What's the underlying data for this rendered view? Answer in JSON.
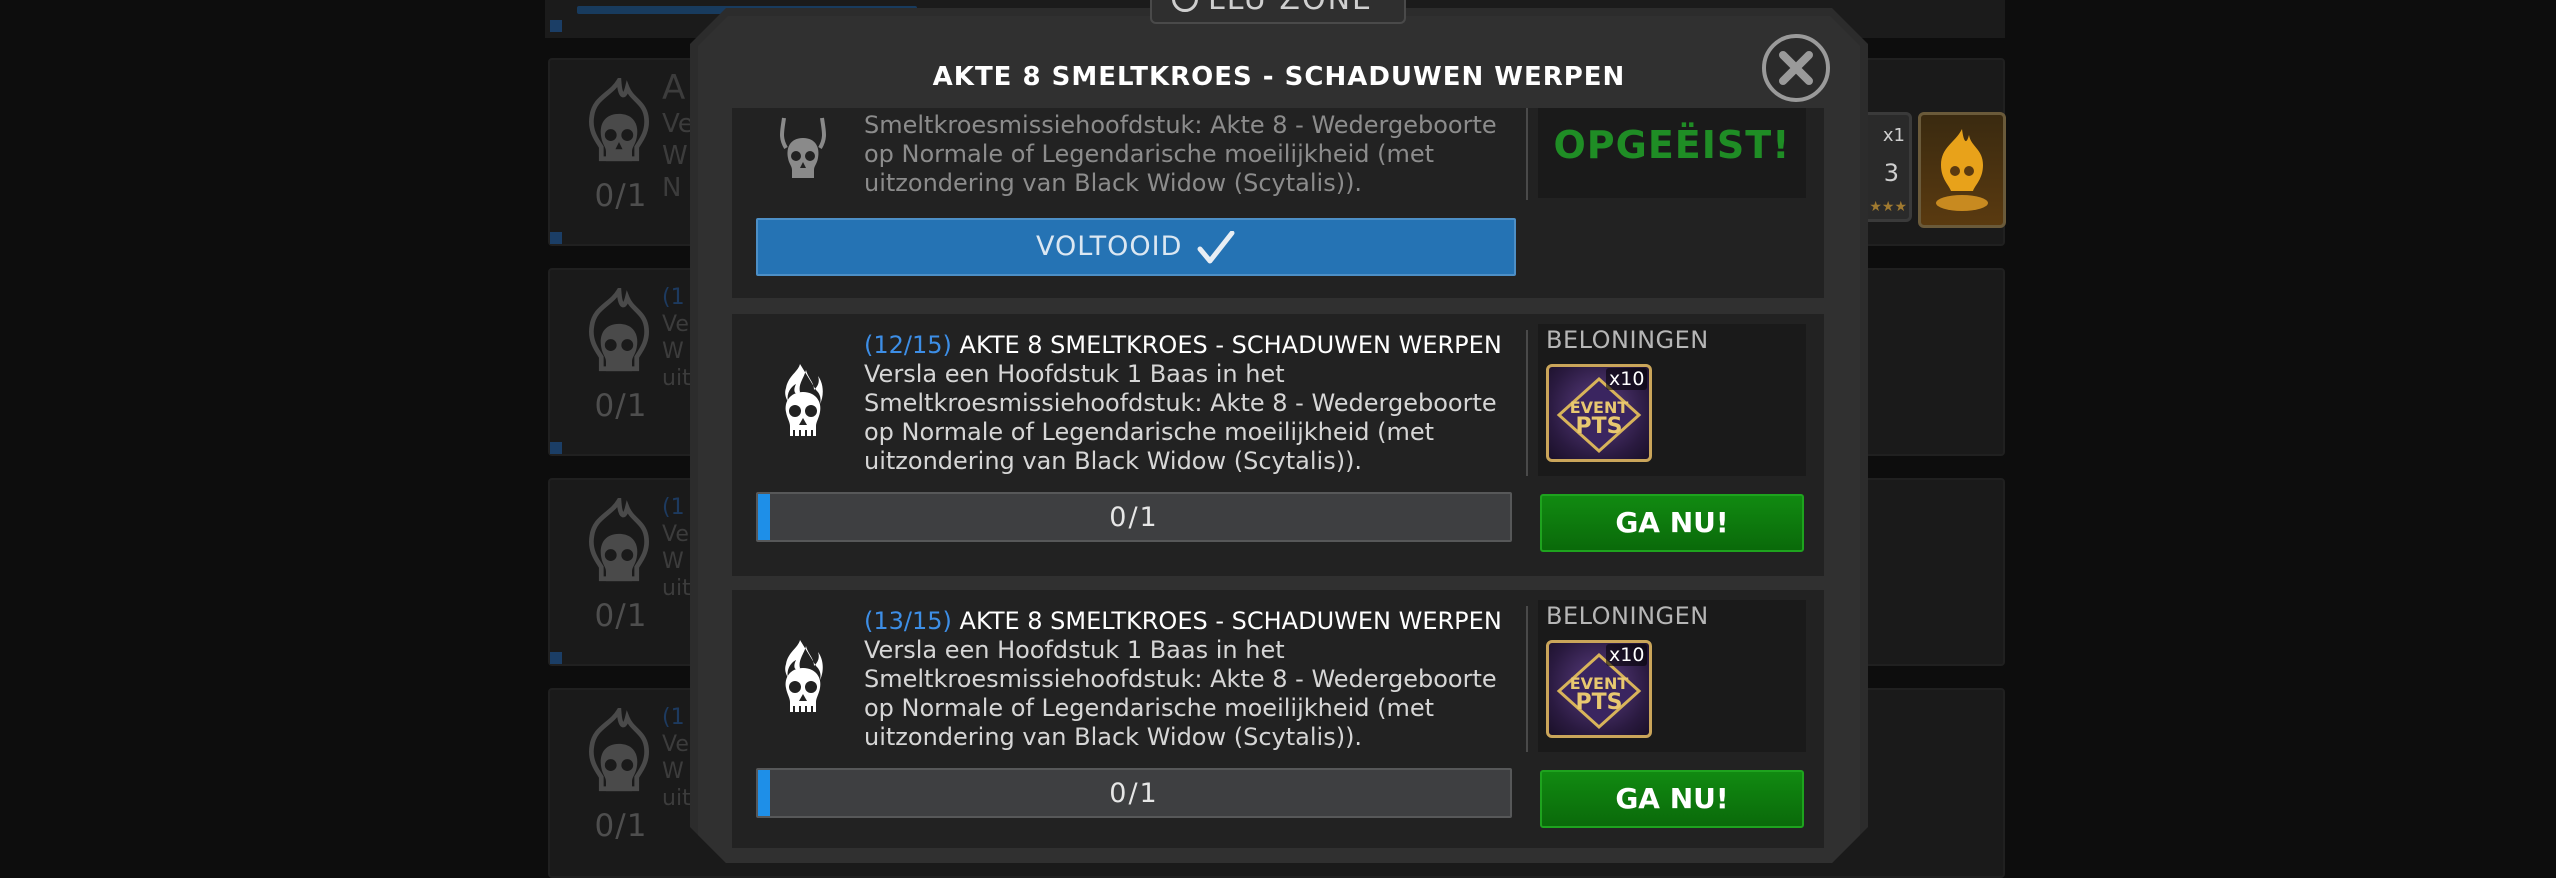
{
  "modal": {
    "timer_text": "LLU ZONE",
    "title": "AKTE 8 SMELTKROES - SCHADUWEN WERPEN"
  },
  "background": {
    "cards": [
      {
        "count": "0/1",
        "lines": [
          "A",
          "Ve",
          "W",
          "N"
        ],
        "num": ""
      },
      {
        "count": "0/1",
        "lines": [
          "Ve",
          "W",
          "uit"
        ],
        "num": "(1"
      },
      {
        "count": "0/1",
        "lines": [
          "Ve",
          "W",
          "uit"
        ],
        "num": "(1"
      },
      {
        "count": "0/1",
        "lines": [
          "Ve",
          "W",
          "uit"
        ],
        "num": "(1"
      }
    ],
    "reward_qty": "x1",
    "reward_level": "3",
    "reward_stars": "★★★"
  },
  "missions": [
    {
      "desc_lines": [
        "Smeltkroesmissiehoofdstuk: Akte 8 - Wedergeboorte",
        "op Normale of Legendarische moeilijkheid (met",
        "uitzondering van Black Widow (Scytalis))."
      ],
      "status_label": "VOLTOOID",
      "claimed_label": "OPGEËIST!"
    },
    {
      "number": "(12/15)",
      "heading": "AKTE 8 SMELTKROES - SCHADUWEN WERPEN",
      "desc_lines": [
        "Versla een Hoofdstuk 1 Baas in het",
        "Smeltkroesmissiehoofdstuk: Akte 8 - Wedergeboorte",
        "op Normale of Legendarische moeilijkheid (met",
        "uitzondering van Black Widow (Scytalis))."
      ],
      "rewards_title": "BELONINGEN",
      "reward_qty": "x10",
      "progress_label": "0/1",
      "progress_fraction": 0,
      "button_label": "GA NU!"
    },
    {
      "number": "(13/15)",
      "heading": "AKTE 8 SMELTKROES - SCHADUWEN WERPEN",
      "desc_lines": [
        "Versla een Hoofdstuk 1 Baas in het",
        "Smeltkroesmissiehoofdstuk: Akte 8 - Wedergeboorte",
        "op Normale of Legendarische moeilijkheid (met",
        "uitzondering van Black Widow (Scytalis))."
      ],
      "rewards_title": "BELONINGEN",
      "reward_qty": "x10",
      "progress_label": "0/1",
      "progress_fraction": 0,
      "button_label": "GA NU!"
    }
  ],
  "icons": {
    "mission": "flaming-skull-icon",
    "close": "close-icon",
    "check": "checkmark-icon",
    "token": "event-token-icon",
    "timer": "clock-icon"
  },
  "colors": {
    "accent_blue": "#3d8ee6",
    "go_green": "#0a7a0a",
    "claimed_green": "#1f8d25",
    "done_blue": "#2573b4"
  }
}
